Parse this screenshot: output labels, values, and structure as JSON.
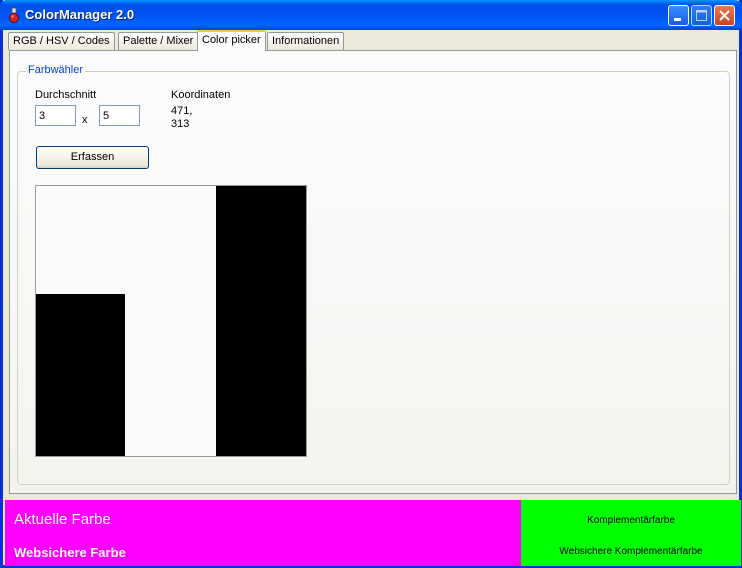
{
  "window": {
    "title": "ColorManager 2.0",
    "icon": "flask-icon"
  },
  "tabs": [
    {
      "label": "RGB / HSV / Codes",
      "active": false
    },
    {
      "label": "Palette / Mixer",
      "active": false
    },
    {
      "label": "Color picker",
      "active": true
    },
    {
      "label": "Informationen",
      "active": false
    }
  ],
  "picker": {
    "group_title": "Farbwähler",
    "average_label": "Durchschnitt",
    "average_x": "3",
    "times_symbol": "x",
    "average_y": "5",
    "coords_label": "Koordinaten",
    "coords_line1": "471,",
    "coords_line2": "313",
    "capture_button": "Erfassen"
  },
  "footer": {
    "current_color": "#ff00ff",
    "current_label": "Aktuelle Farbe",
    "websafe_label": "Websichere Farbe",
    "complement_color": "#00ff00",
    "complement_label": "Komplementärfarbe",
    "websafe_complement_label": "Websichere Komplementärfarbe"
  }
}
